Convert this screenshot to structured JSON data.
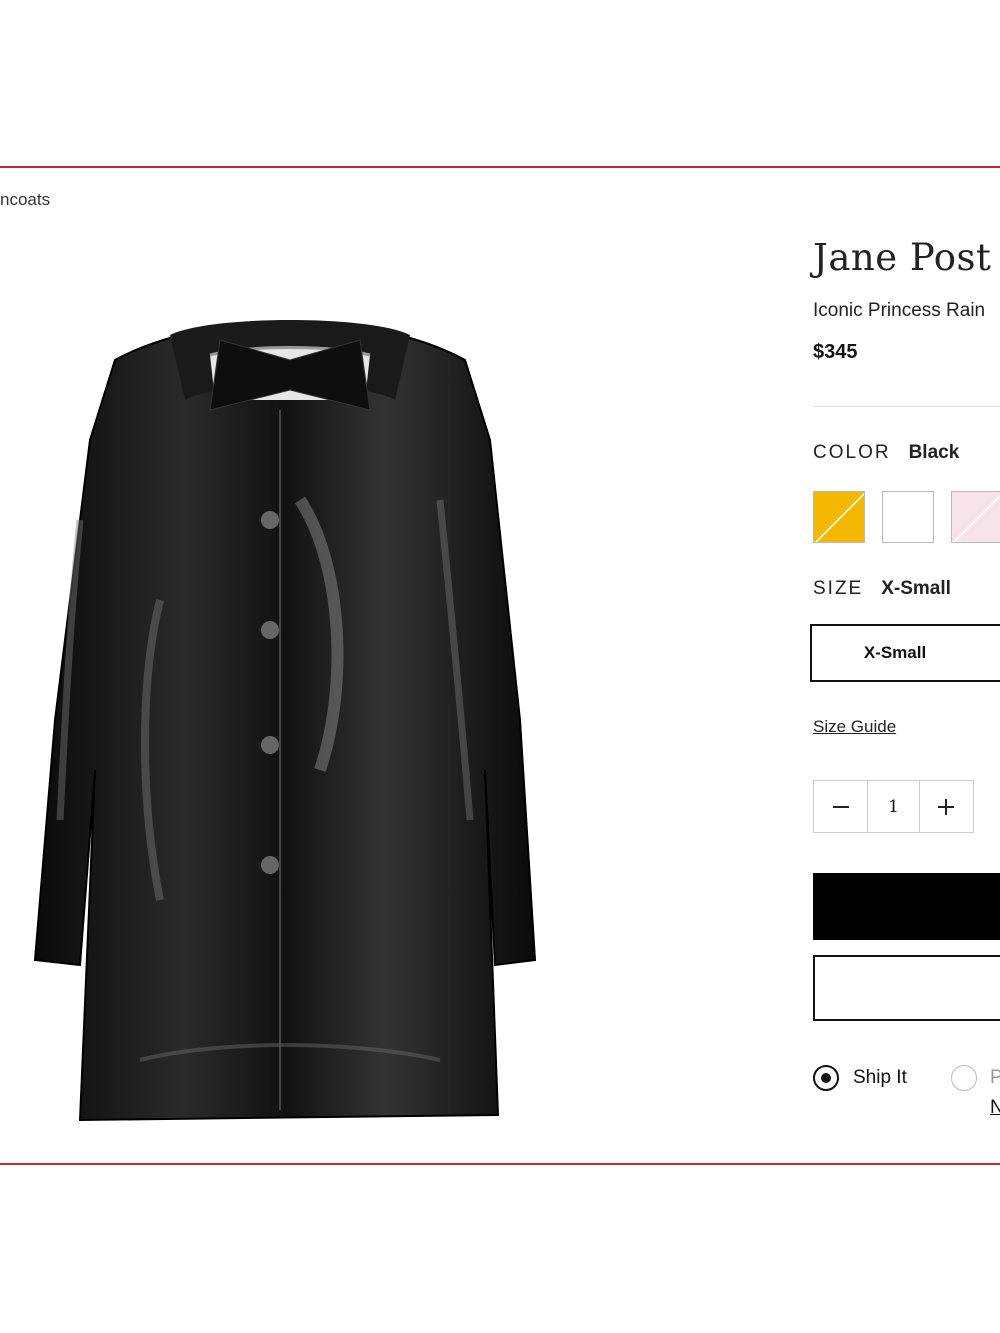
{
  "breadcrumb": "ncoats",
  "product": {
    "brand": "Jane Post",
    "name": "Iconic Princess Rain",
    "price": "$345"
  },
  "color": {
    "label": "COLOR",
    "selected": "Black",
    "swatches": [
      {
        "name": "yellow",
        "hex": "#f5b800"
      },
      {
        "name": "white",
        "hex": "#ffffff"
      },
      {
        "name": "pink",
        "hex": "#f9e3ea"
      }
    ]
  },
  "size": {
    "label": "SIZE",
    "selected": "X-Small",
    "option": "X-Small",
    "guide": "Size Guide"
  },
  "quantity": {
    "minus_icon": "minus-icon",
    "value": "1",
    "plus_icon": "plus-icon"
  },
  "fulfillment": {
    "ship_label": "Ship It",
    "pickup_label": "P",
    "pickup_link": "N"
  },
  "colors": {
    "frame": "#c8232f",
    "accent": "#000000"
  }
}
